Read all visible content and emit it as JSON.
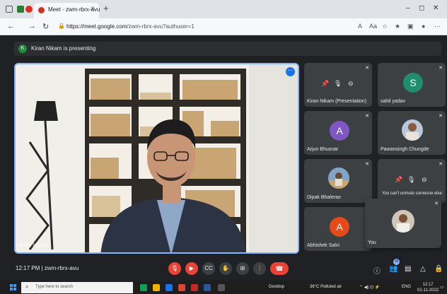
{
  "browser": {
    "tab_title": "Meet - zwm-rbrx-avu",
    "tab_close": "×",
    "new_tab": "+",
    "url_host": "https://meet.google.com",
    "url_path": "/zwm-rbrx-avu?authuser=1",
    "min_glyph": "–",
    "max_glyph": "◻",
    "close_glyph": "✕"
  },
  "meet": {
    "presenting_initial": "K",
    "presenting_text": "Kiran Nikam is presenting",
    "stage_name": "Kiran Nikam",
    "tiles": [
      {
        "name": "Kiran Nikam (Presentation)",
        "kind": "presentation"
      },
      {
        "name": "sahil yadav",
        "initial": "S",
        "color": "#1e8e6e"
      },
      {
        "name": "Arjun Bhusnar",
        "initial": "A",
        "color": "#7e57c2"
      },
      {
        "name": "Pawansingh Chungde",
        "kind": "photo"
      },
      {
        "name": "Dipak Bhalerao",
        "kind": "photo"
      },
      {
        "name": "",
        "kind": "hint",
        "hint": "You can't unmute someone else"
      },
      {
        "name": "Abhishek Salvi",
        "initial": "A",
        "color": "#e64a19"
      }
    ],
    "self_name": "You",
    "time": "12:17 PM",
    "meeting_code": "zwm-rbrx-avu",
    "participant_count": "36"
  },
  "taskbar": {
    "search_placeholder": "Type here to search",
    "desktop_label": "Desktop",
    "weather": "36°C  Polluted air",
    "lang": "ENG",
    "clock_time": "12:17",
    "clock_date": "01-11-2022"
  },
  "colors": {
    "accent": "#1a73e8",
    "danger": "#ea4335",
    "meet_bg": "#202124",
    "tile_bg": "#3c4043"
  }
}
